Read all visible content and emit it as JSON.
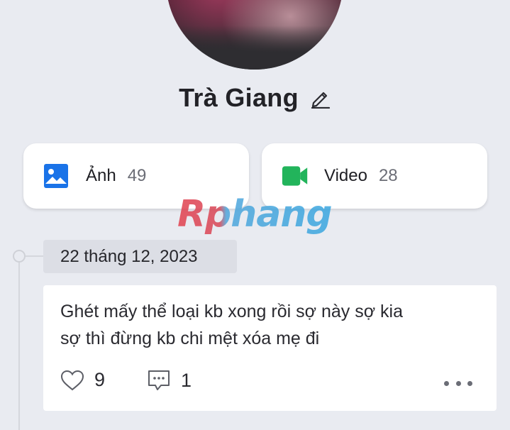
{
  "profile": {
    "name": "Trà Giang"
  },
  "media": {
    "photos": {
      "label": "Ảnh",
      "count": "49",
      "icon": "image-icon",
      "color": "#1a73e8"
    },
    "videos": {
      "label": "Video",
      "count": "28",
      "icon": "video-camera-icon",
      "color": "#22b45b"
    }
  },
  "watermark": {
    "text": "Rphang"
  },
  "timeline": {
    "date": "22 tháng 12, 2023",
    "post": {
      "text_line1": "Ghét mấy thể loại kb xong rồi sợ này sợ kia",
      "text_line2": "sợ thì đừng kb chi mệt xóa mẹ đi",
      "likes": "9",
      "comments": "1"
    }
  }
}
